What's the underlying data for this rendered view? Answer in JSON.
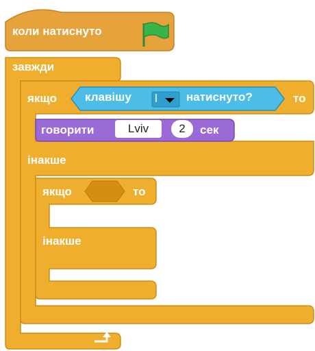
{
  "script": {
    "hat_label": "коли натиснуто",
    "forever_label": "завжди",
    "if_label": "якщо",
    "then_label": "то",
    "key_sensor_prefix": "клавішу",
    "key_value": "l",
    "key_sensor_suffix": "натиснуто?",
    "say_label": "говорити",
    "say_text": "Lviv",
    "say_seconds": "2",
    "say_unit": "сек",
    "else_label": "інакше",
    "inner_if_label": "якщо",
    "inner_then_label": "то",
    "inner_else_label": "інакше"
  },
  "icons": {
    "flag": "green-flag-icon",
    "loop_arrow": "loop-arrow-icon",
    "dropdown": "dropdown-arrow-icon"
  },
  "colors": {
    "events": "#e6a33b",
    "events_border": "#cc7f20",
    "control": "#f0ae2e",
    "control_border": "#cf8b17",
    "sensing": "#4cbde8",
    "sensing_border": "#2e8eb8",
    "looks": "#9a6bd6",
    "looks_border": "#7749b3",
    "flag": "#38b449"
  }
}
